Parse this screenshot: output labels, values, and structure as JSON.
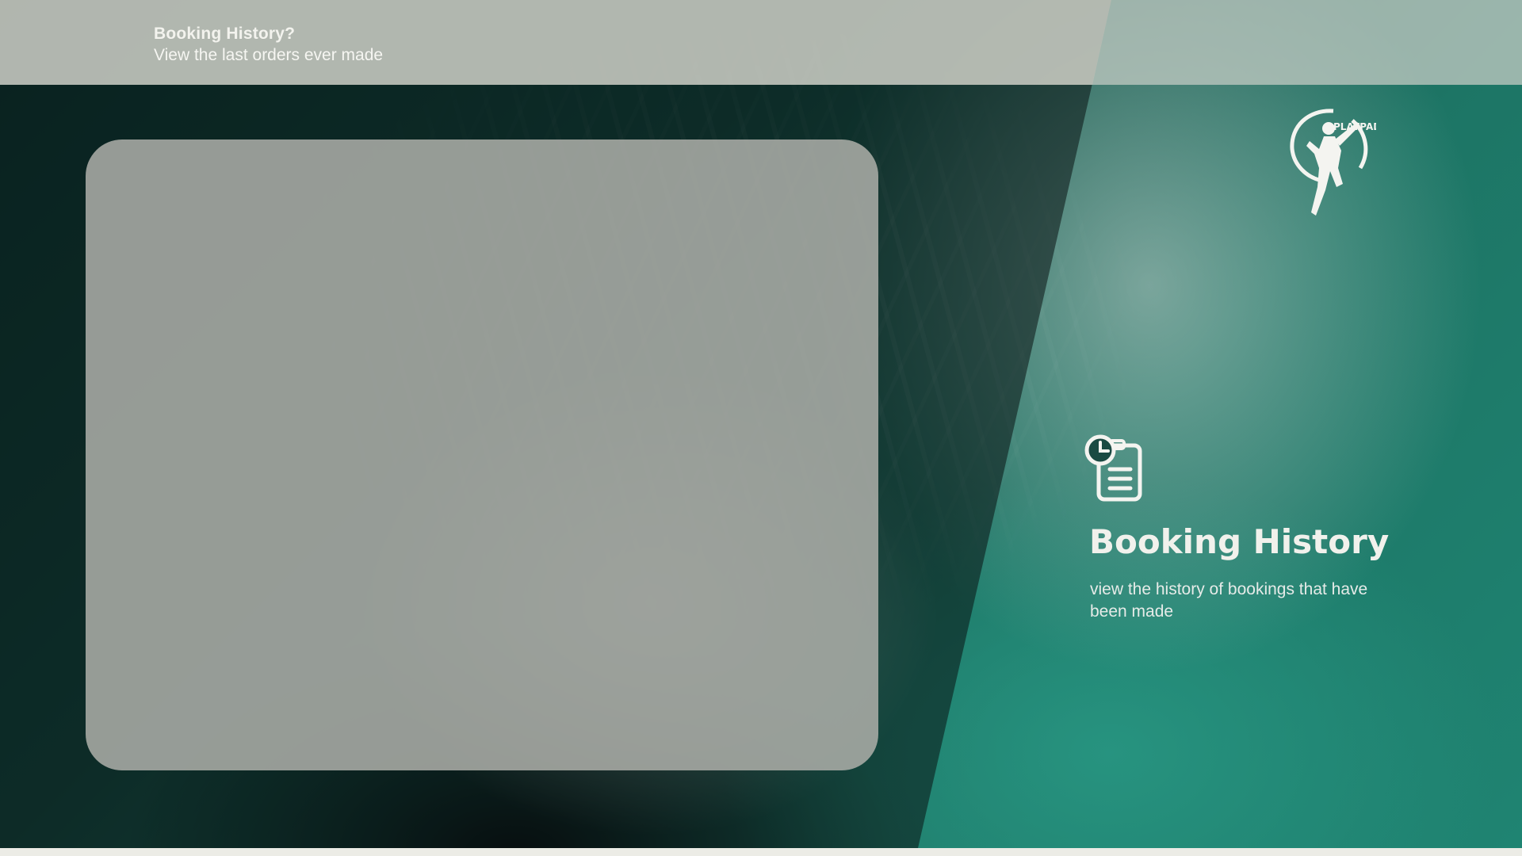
{
  "header": {
    "title": "Booking History?",
    "subtitle": "View the last orders ever made"
  },
  "logo": {
    "text": "PLAYPAD",
    "icon": "badminton-player-logo-icon"
  },
  "info": {
    "icon": "clock-document-icon",
    "title": "Booking History",
    "description": "view the history of bookings that have been made"
  },
  "colors": {
    "accent_teal": "#1d7565",
    "header_band": "#bec8c0",
    "panel": "#aaaca6",
    "text_light": "#f1f1ec"
  }
}
